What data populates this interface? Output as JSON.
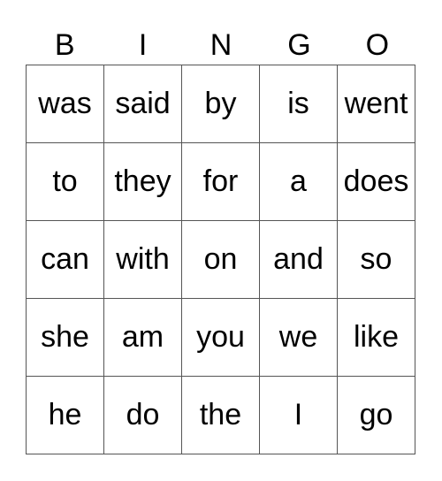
{
  "header": [
    "B",
    "I",
    "N",
    "G",
    "O"
  ],
  "cells": [
    [
      "was",
      "said",
      "by",
      "is",
      "went"
    ],
    [
      "to",
      "they",
      "for",
      "a",
      "does"
    ],
    [
      "can",
      "with",
      "on",
      "and",
      "so"
    ],
    [
      "she",
      "am",
      "you",
      "we",
      "like"
    ],
    [
      "he",
      "do",
      "the",
      "I",
      "go"
    ]
  ]
}
